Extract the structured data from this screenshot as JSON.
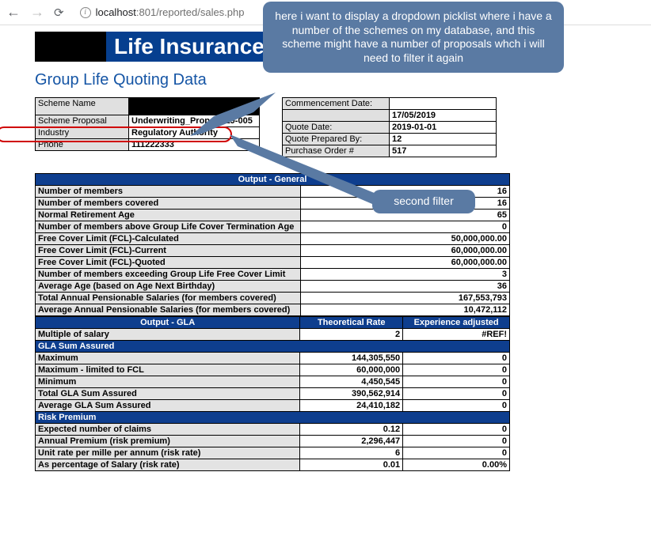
{
  "browser": {
    "url_host": "localhost",
    "url_path": ":801/reported/sales.php"
  },
  "header": {
    "title": "Life Insurance"
  },
  "page_title": "Group Life Quoting Data",
  "callouts": {
    "main": "here i want to display a dropdown picklist where i have a number of the schemes on my database, and this scheme might have a number of proposals whch i will need to filter it again",
    "second": "second filter"
  },
  "left_info": {
    "scheme_name_lbl": "Scheme Name",
    "proposal_lbl": "Scheme Proposal",
    "proposal_val": "Underwriting_Prop-01-19-005",
    "industry_lbl": "Industry",
    "industry_val": "Regulatory Authority",
    "phone_lbl": "Phone",
    "phone_val": "111222333"
  },
  "right_info": {
    "commence_lbl": "Commencement Date:",
    "commence_val": "17/05/2019",
    "quote_date_lbl": "Quote Date:",
    "quote_date_val": "2019-01-01",
    "prepared_lbl": "Quote Prepared By:",
    "prepared_val": "12",
    "po_lbl": "Purchase Order #",
    "po_val": "517"
  },
  "output_general": {
    "title": "Output - General",
    "num_members_lbl": "Number of members",
    "num_members_val": "16",
    "num_covered_lbl": "Number of members covered",
    "num_covered_val": "16",
    "retire_lbl": "Normal Retirement Age",
    "retire_val": "65",
    "above_term_lbl": "Number of members above Group Life Cover Termination Age",
    "above_term_val": "0",
    "fcl_calc_lbl": "Free Cover Limit (FCL)-Calculated",
    "fcl_calc_val": "50,000,000.00",
    "fcl_curr_lbl": "Free Cover Limit (FCL)-Current",
    "fcl_curr_val": "60,000,000.00",
    "fcl_quot_lbl": "Free Cover Limit (FCL)-Quoted",
    "fcl_quot_val": "60,000,000.00",
    "exceed_lbl": "Number of members exceeding Group Life Free Cover Limit",
    "exceed_val": "3",
    "avg_age_lbl": "Average Age (based on Age Next Birthday)",
    "avg_age_val": "36",
    "tot_sal_lbl": "Total Annual Pensionable Salaries (for members covered)",
    "tot_sal_val": "167,553,793",
    "avg_sal_lbl": "Average Annual Pensionable Salaries (for members covered)",
    "avg_sal_val": "10,472,112"
  },
  "output_gla": {
    "title": "Output - GLA",
    "theo_hdr": "Theoretical Rate",
    "exp_hdr": "Experience adjusted",
    "mult_lbl": "Multiple of salary",
    "mult_v1": "2",
    "mult_v2": "#REF!",
    "gla_sum_hdr": "GLA Sum Assured",
    "max_lbl": "Maximum",
    "max_v1": "144,305,550",
    "max_v2": "0",
    "max_fcl_lbl": "Maximum - limited to FCL",
    "max_fcl_v1": "60,000,000",
    "max_fcl_v2": "0",
    "min_lbl": "Minimum",
    "min_v1": "4,450,545",
    "min_v2": "0",
    "tot_gla_lbl": "Total GLA Sum Assured",
    "tot_gla_v1": "390,562,914",
    "tot_gla_v2": "0",
    "avg_gla_lbl": "Average GLA Sum Assured",
    "avg_gla_v1": "24,410,182",
    "avg_gla_v2": "0",
    "risk_hdr": "Risk Premium",
    "exp_claims_lbl": "Expected number of claims",
    "exp_claims_v1": "0.12",
    "exp_claims_v2": "0",
    "ann_prem_lbl": "Annual Premium (risk premium)",
    "ann_prem_v1": "2,296,447",
    "ann_prem_v2": "0",
    "unit_rate_lbl": "Unit rate per mille per annum (risk rate)",
    "unit_rate_v1": "6",
    "unit_rate_v2": "0",
    "pct_sal_lbl": "As percentage of Salary (risk rate)",
    "pct_sal_v1": "0.01",
    "pct_sal_v2": "0.00%"
  }
}
